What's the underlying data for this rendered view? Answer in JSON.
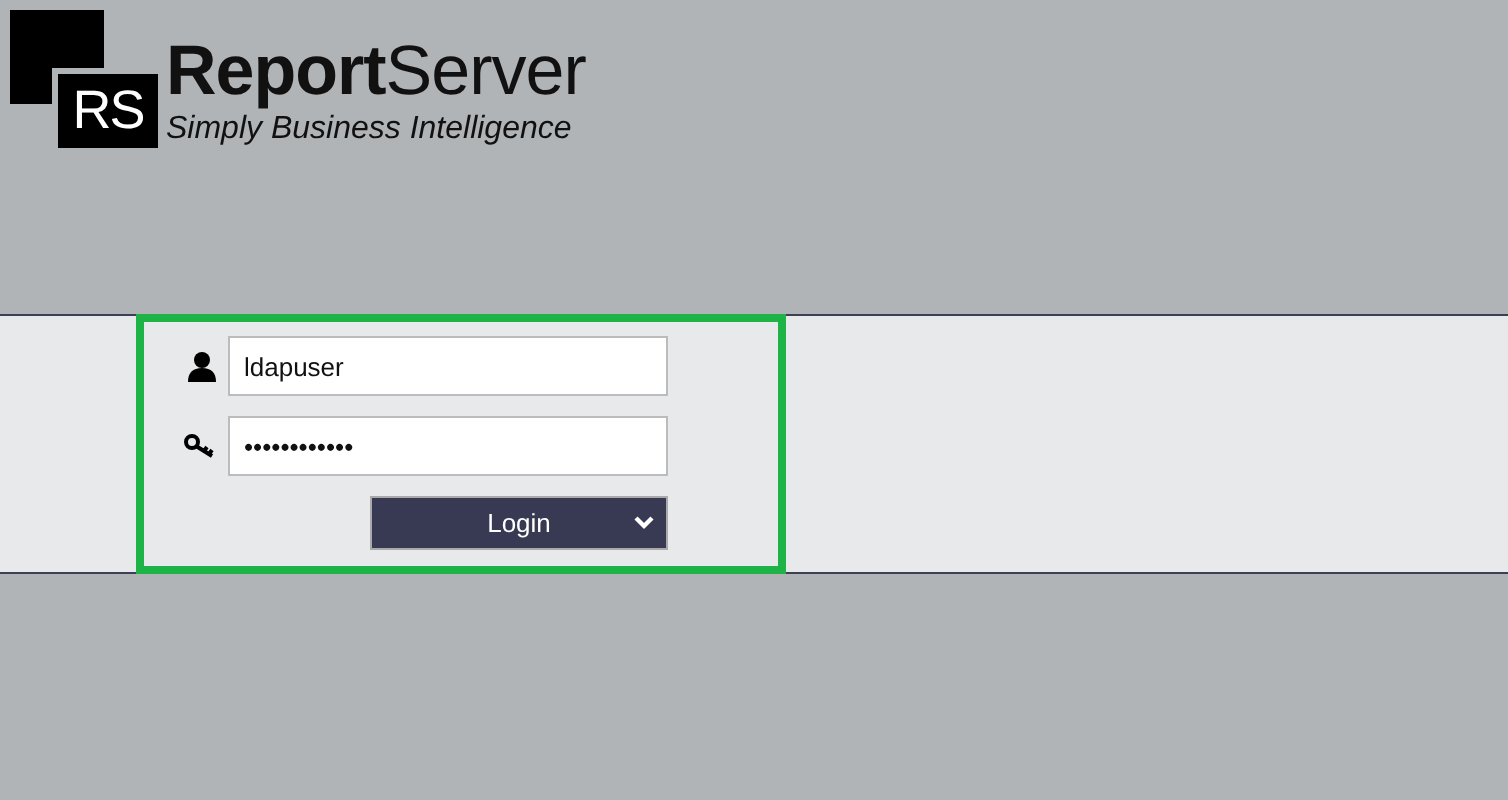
{
  "logo": {
    "mark": "RS",
    "title": "**Report**Server",
    "tagline": "Simply Business Intelligence"
  },
  "login": {
    "username": {
      "value": "ldapuser"
    },
    "password": {
      "value": "••••••••••••"
    },
    "button": "Login",
    "focused": true
  }
}
